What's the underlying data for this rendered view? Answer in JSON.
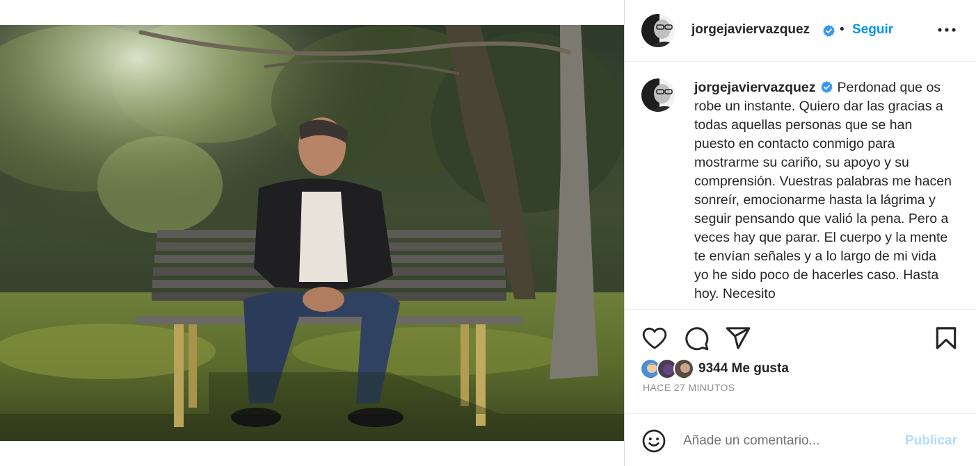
{
  "post": {
    "username": "jorgejaviervazquez",
    "follow_label": "Seguir",
    "separator": "•",
    "caption_text": "Perdonad que os robe un instante. Quiero dar las gracias a todas aquellas personas que se han puesto en contacto conmigo para mostrarme su cariño, su apoyo y su comprensión. Vuestras palabras me hacen sonreír, emocionarme hasta la lágrima y seguir pensando que valió la pena. Pero a veces hay que parar. El cuerpo y la mente te envían señales y a lo largo de mi vida yo he sido poco de hacerles caso. Hasta hoy. Necesito",
    "likes": "9344 Me gusta",
    "time": "HACE 27 MINUTOS"
  },
  "comment": {
    "placeholder": "Añade un comentario...",
    "publish_label": "Publicar"
  },
  "icons": {
    "verified": "verified-badge-icon",
    "more": "more-options-icon",
    "like": "heart-icon",
    "comment": "comment-bubble-icon",
    "share": "paper-plane-icon",
    "save": "bookmark-icon",
    "emoji": "emoji-icon"
  },
  "colors": {
    "accent": "#0095f6",
    "publish_disabled": "#b3dbff",
    "text": "#262626",
    "muted": "#8e8e8e"
  }
}
